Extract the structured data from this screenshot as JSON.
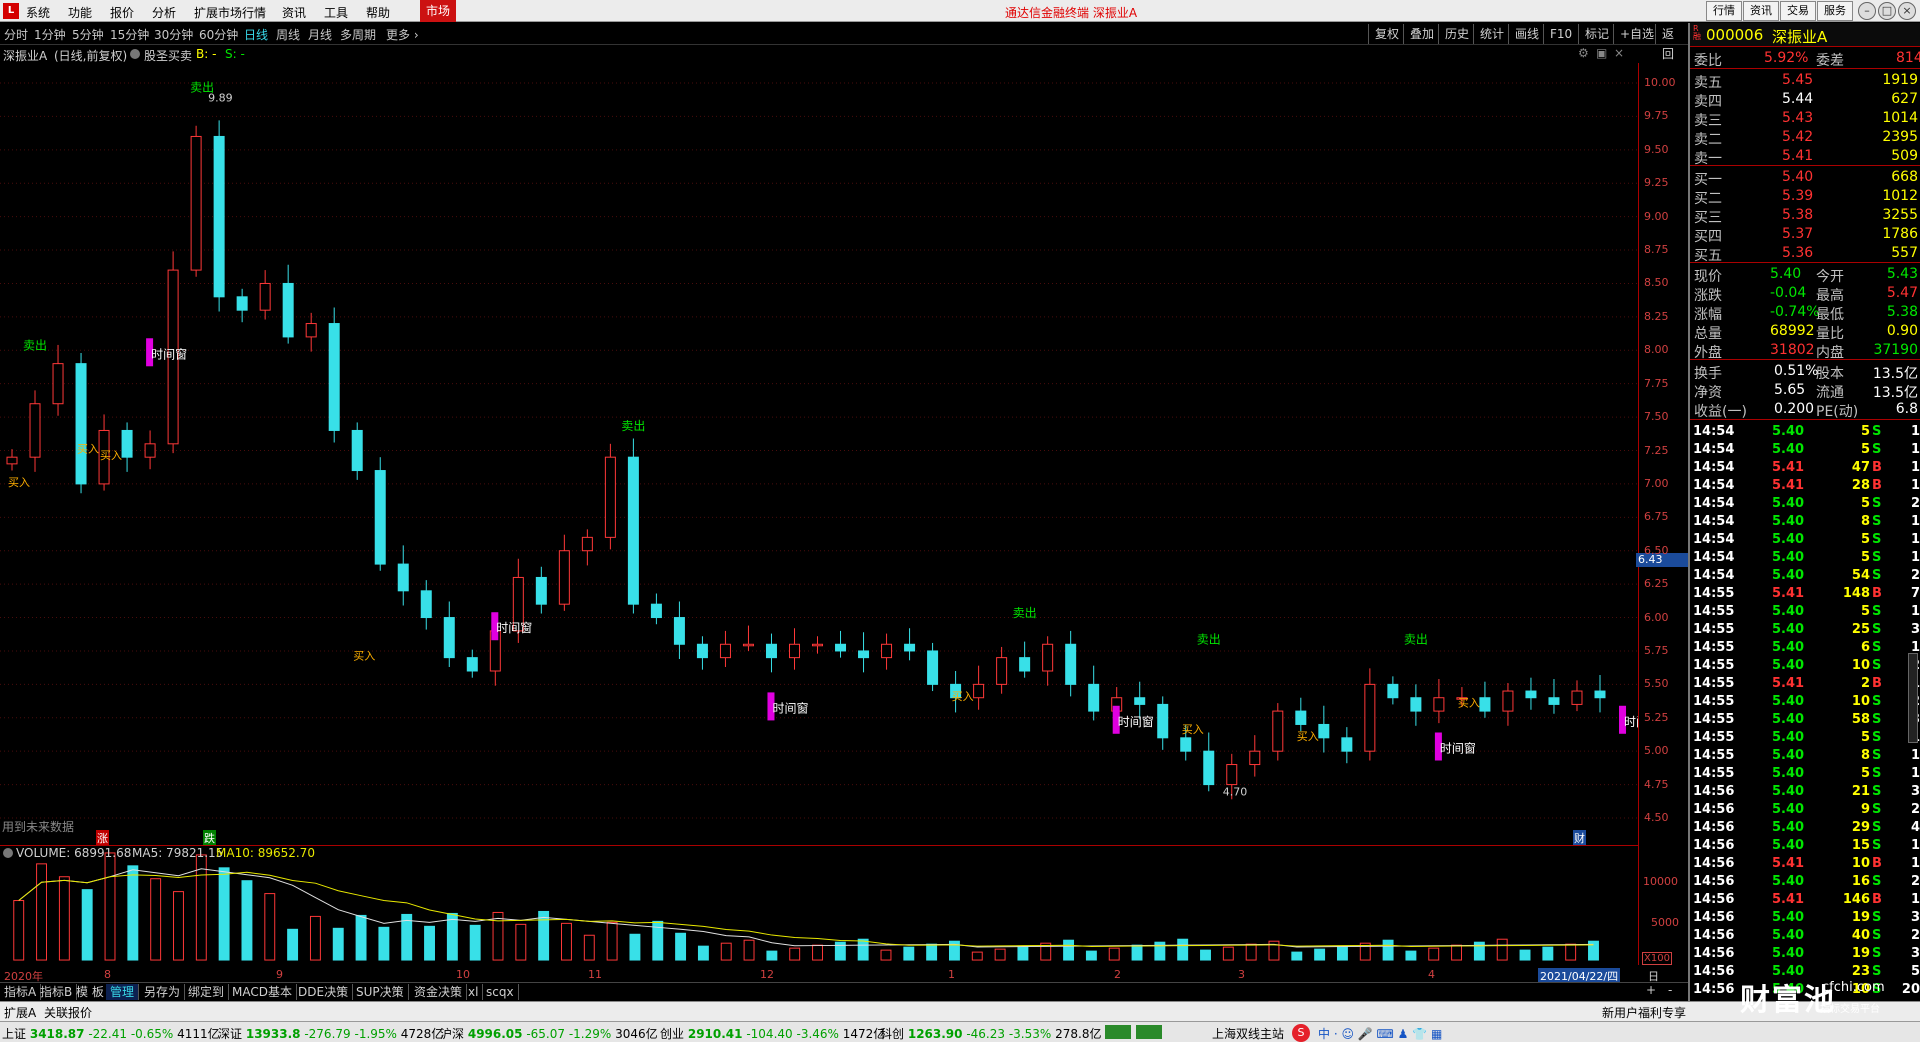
{
  "menubar": {
    "logo": "L",
    "items": [
      "系统",
      "功能",
      "报价",
      "分析",
      "扩展市场行情",
      "资讯",
      "工具",
      "帮助"
    ],
    "market": "市场",
    "title": "通达信金融终端  深振业A",
    "right_buttons": [
      "行情",
      "资讯",
      "交易",
      "服务"
    ]
  },
  "toolbar": {
    "periods": [
      "分时",
      "1分钟",
      "5分钟",
      "15分钟",
      "30分钟",
      "60分钟",
      "日线",
      "周线",
      "月线",
      "多周期",
      "更多 ›"
    ],
    "active_period": "日线",
    "buttons": [
      "复权",
      "叠加",
      "历史",
      "统计",
      "画线",
      "F10",
      "标记",
      "+自选",
      "返回"
    ]
  },
  "info": {
    "stock": "深振业A",
    "mode": "(日线,前复权)",
    "indicator": "股圣买卖",
    "b": "B: -",
    "s": "S: -",
    "future_note": "用到未来数据",
    "zhang": "涨",
    "die": "跌",
    "cai": "财"
  },
  "price_axis": [
    "10.00",
    "9.75",
    "9.50",
    "9.25",
    "9.00",
    "8.75",
    "8.50",
    "8.25",
    "8.00",
    "7.75",
    "7.50",
    "7.25",
    "7.00",
    "6.75",
    "6.50",
    "6.25",
    "6.00",
    "5.75",
    "5.50",
    "5.25",
    "5.00",
    "4.75",
    "4.50"
  ],
  "current_price_tag": "6.43",
  "annotations": {
    "high": "9.89",
    "low": "4.70",
    "sell": "卖出",
    "buy": "买入",
    "window": "时间窗"
  },
  "volume": {
    "label": "VOLUME: 68991.68",
    "ma5": "MA5: 79821.15",
    "ma10": "MA10: 89652.70",
    "scale": [
      "10000",
      "5000"
    ],
    "unit": "X100"
  },
  "date_axis": [
    "2020年",
    "8",
    "9",
    "10",
    "11",
    "12",
    "1",
    "2",
    "3",
    "4"
  ],
  "date_current": "2021/04/22/四",
  "date_period": "日线",
  "bottom_tabs": [
    "指标A",
    "指标B",
    "模 板",
    "管理",
    "另存为",
    "绑定到",
    "MACD基本",
    "DDE决策",
    "SUP决策",
    "资金决策",
    "xl",
    "scqx"
  ],
  "bottom_tabs_selected": "管理",
  "secbar": {
    "left": [
      "扩展A",
      "关联报价"
    ],
    "right": "新用户福利专享"
  },
  "status": {
    "indices": [
      {
        "name": "上证",
        "value": "3418.87",
        "chg": "-22.41",
        "pct": "-0.65%",
        "amt": "4111亿"
      },
      {
        "name": "深证",
        "value": "13933.8",
        "chg": "-276.79",
        "pct": "-1.95%",
        "amt": "4728亿"
      },
      {
        "name": "沪深",
        "value": "4996.05",
        "chg": "-65.07",
        "pct": "-1.29%",
        "amt": "3046亿"
      },
      {
        "name": "创业",
        "value": "2910.41",
        "chg": "-104.40",
        "pct": "-3.46%",
        "amt": "1472亿"
      },
      {
        "name": "科创",
        "value": "1263.90",
        "chg": "-46.23",
        "pct": "-3.53%",
        "amt": "278.8亿"
      }
    ],
    "site": "上海双线主站",
    "brand": "财富池",
    "brand_url": "cfchi.com",
    "brand_sub": "指标交易平台"
  },
  "quote": {
    "code": "000006",
    "name": "深振业A",
    "wb_label": "委比",
    "wb": "5.92%",
    "wc_label": "委差",
    "wc": "814",
    "asks": [
      {
        "label": "卖五",
        "price": "5.45",
        "vol": "1919"
      },
      {
        "label": "卖四",
        "price": "5.44",
        "vol": "627"
      },
      {
        "label": "卖三",
        "price": "5.43",
        "vol": "1014"
      },
      {
        "label": "卖二",
        "price": "5.42",
        "vol": "2395"
      },
      {
        "label": "卖一",
        "price": "5.41",
        "vol": "509"
      }
    ],
    "bids": [
      {
        "label": "买一",
        "price": "5.40",
        "vol": "668"
      },
      {
        "label": "买二",
        "price": "5.39",
        "vol": "1012"
      },
      {
        "label": "买三",
        "price": "5.38",
        "vol": "3255"
      },
      {
        "label": "买四",
        "price": "5.37",
        "vol": "1786"
      },
      {
        "label": "买五",
        "price": "5.36",
        "vol": "557"
      }
    ],
    "stats": [
      {
        "l1": "现价",
        "v1": "5.40",
        "c1": "grn",
        "l2": "今开",
        "v2": "5.43",
        "c2": "grn"
      },
      {
        "l1": "涨跌",
        "v1": "-0.04",
        "c1": "grn",
        "l2": "最高",
        "v2": "5.47",
        "c2": "red"
      },
      {
        "l1": "涨幅",
        "v1": "-0.74%",
        "c1": "grn",
        "l2": "最低",
        "v2": "5.38",
        "c2": "grn"
      },
      {
        "l1": "总量",
        "v1": "68992",
        "c1": "yel",
        "l2": "量比",
        "v2": "0.90",
        "c2": "yel"
      },
      {
        "l1": "外盘",
        "v1": "31802",
        "c1": "red",
        "l2": "内盘",
        "v2": "37190",
        "c2": "grn"
      }
    ],
    "stats2": [
      {
        "l1": "换手",
        "v1": "0.51%",
        "l2": "股本",
        "v2": "13.5亿"
      },
      {
        "l1": "净资",
        "v1": "5.65",
        "l2": "流通",
        "v2": "13.5亿"
      },
      {
        "l1": "收益(一)",
        "v1": "0.200",
        "l2": "PE(动)",
        "v2": "6.8"
      }
    ],
    "ticks": [
      [
        "14:54",
        "5.40",
        "5",
        "S",
        "1"
      ],
      [
        "14:54",
        "5.40",
        "5",
        "S",
        "1"
      ],
      [
        "14:54",
        "5.41",
        "47",
        "B",
        "1"
      ],
      [
        "14:54",
        "5.41",
        "28",
        "B",
        "1"
      ],
      [
        "14:54",
        "5.40",
        "5",
        "S",
        "2"
      ],
      [
        "14:54",
        "5.40",
        "8",
        "S",
        "1"
      ],
      [
        "14:54",
        "5.40",
        "5",
        "S",
        "1"
      ],
      [
        "14:54",
        "5.40",
        "5",
        "S",
        "1"
      ],
      [
        "14:54",
        "5.40",
        "54",
        "S",
        "2"
      ],
      [
        "14:55",
        "5.41",
        "148",
        "B",
        "7"
      ],
      [
        "14:55",
        "5.40",
        "5",
        "S",
        "1"
      ],
      [
        "14:55",
        "5.40",
        "25",
        "S",
        "3"
      ],
      [
        "14:55",
        "5.40",
        "6",
        "S",
        "1"
      ],
      [
        "14:55",
        "5.40",
        "10",
        "S",
        "2"
      ],
      [
        "14:55",
        "5.41",
        "2",
        "B",
        "1"
      ],
      [
        "14:55",
        "5.40",
        "10",
        "S",
        "2"
      ],
      [
        "14:55",
        "5.40",
        "58",
        "S",
        "3"
      ],
      [
        "14:55",
        "5.40",
        "5",
        "S",
        "1"
      ],
      [
        "14:55",
        "5.40",
        "8",
        "S",
        "1"
      ],
      [
        "14:55",
        "5.40",
        "5",
        "S",
        "1"
      ],
      [
        "14:56",
        "5.40",
        "21",
        "S",
        "3"
      ],
      [
        "14:56",
        "5.40",
        "9",
        "S",
        "2"
      ],
      [
        "14:56",
        "5.40",
        "29",
        "S",
        "4"
      ],
      [
        "14:56",
        "5.40",
        "15",
        "S",
        "1"
      ],
      [
        "14:56",
        "5.41",
        "10",
        "B",
        "1"
      ],
      [
        "14:56",
        "5.40",
        "16",
        "S",
        "2"
      ],
      [
        "14:56",
        "5.41",
        "146",
        "B",
        "1"
      ],
      [
        "14:56",
        "5.40",
        "19",
        "S",
        "3"
      ],
      [
        "14:56",
        "5.40",
        "40",
        "S",
        "2"
      ],
      [
        "14:56",
        "5.40",
        "19",
        "S",
        "3"
      ],
      [
        "14:56",
        "5.40",
        "23",
        "S",
        "5"
      ],
      [
        "14:56",
        "5.40",
        "10",
        "S",
        "20"
      ]
    ]
  },
  "chart_data": {
    "type": "candlestick",
    "title": "",
    "y_range": [
      4.5,
      10.0
    ],
    "series_hint": "daily OHLC approx, red = up, cyan = down",
    "closes": [
      7.2,
      7.6,
      7.9,
      7.0,
      7.4,
      7.2,
      7.3,
      8.6,
      9.6,
      8.4,
      8.3,
      8.5,
      8.1,
      8.2,
      7.4,
      7.1,
      6.4,
      6.2,
      6.0,
      5.7,
      5.6,
      5.9,
      6.3,
      6.1,
      6.5,
      6.6,
      7.2,
      6.1,
      6.0,
      5.8,
      5.7,
      5.8,
      5.8,
      5.7,
      5.8,
      5.8,
      5.75,
      5.7,
      5.8,
      5.75,
      5.5,
      5.4,
      5.5,
      5.7,
      5.6,
      5.8,
      5.5,
      5.3,
      5.4,
      5.35,
      5.1,
      5.0,
      4.75,
      4.9,
      5.0,
      5.3,
      5.2,
      5.1,
      5.0,
      5.5,
      5.4,
      5.3,
      5.4,
      5.4,
      5.3,
      5.45,
      5.4,
      5.35,
      5.45,
      5.4
    ],
    "annotations": [
      {
        "type": "high",
        "value": 9.89
      },
      {
        "type": "low",
        "value": 4.7
      }
    ]
  }
}
